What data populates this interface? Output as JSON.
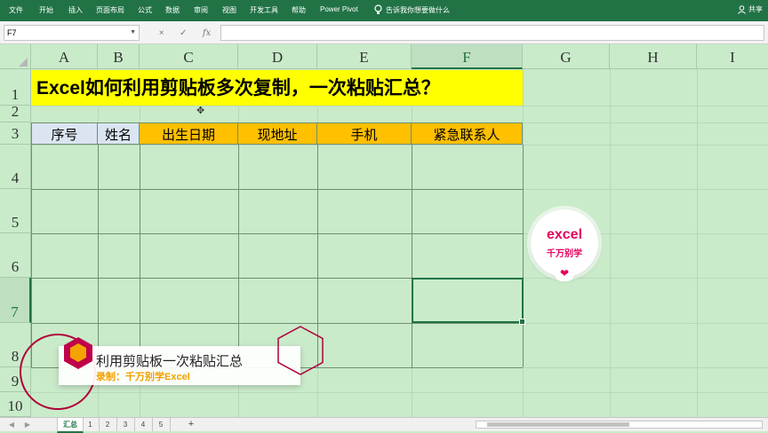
{
  "ribbon": {
    "tabs": [
      "文件",
      "开始",
      "插入",
      "页面布局",
      "公式",
      "数据",
      "审阅",
      "视图",
      "开发工具",
      "帮助",
      "Power Pivot"
    ],
    "tell_me": "告诉我你想要做什么",
    "share": "共享"
  },
  "formula_bar": {
    "name_box": "F7",
    "cancel_symbol": "×",
    "enter_symbol": "✓",
    "fx_symbol": "fx",
    "content": ""
  },
  "columns": [
    "A",
    "B",
    "C",
    "D",
    "E",
    "F",
    "G",
    "H",
    "I"
  ],
  "selected_column": "F",
  "rows": [
    "1",
    "2",
    "3",
    "4",
    "5",
    "6",
    "7",
    "8",
    "9",
    "10"
  ],
  "selected_row": "7",
  "sheet": {
    "title": "Excel如何利用剪贴板多次复制，一次粘贴汇总？",
    "headers": [
      "序号",
      "姓名",
      "出生日期",
      "现地址",
      "手机",
      "紧急联系人"
    ],
    "active_cell": "F7"
  },
  "sheet_tabs": [
    "汇总",
    "1",
    "2",
    "3",
    "4",
    "5"
  ],
  "active_sheet_tab": "汇总",
  "add_sheet": "+",
  "nav_prev": "◀",
  "nav_next": "▶",
  "logo": {
    "line1": "excel",
    "line2": "千万别学"
  },
  "banner": {
    "title": "利用剪贴板一次粘贴汇总",
    "subtitle": "录制：千万别学Excel"
  },
  "colors": {
    "ribbon": "#217346",
    "grid_background": "#c9ebca",
    "title_fill": "#ffff00",
    "header_blue": "#dbe5f1",
    "header_orange": "#ffc000",
    "accent": "#e4005f"
  }
}
